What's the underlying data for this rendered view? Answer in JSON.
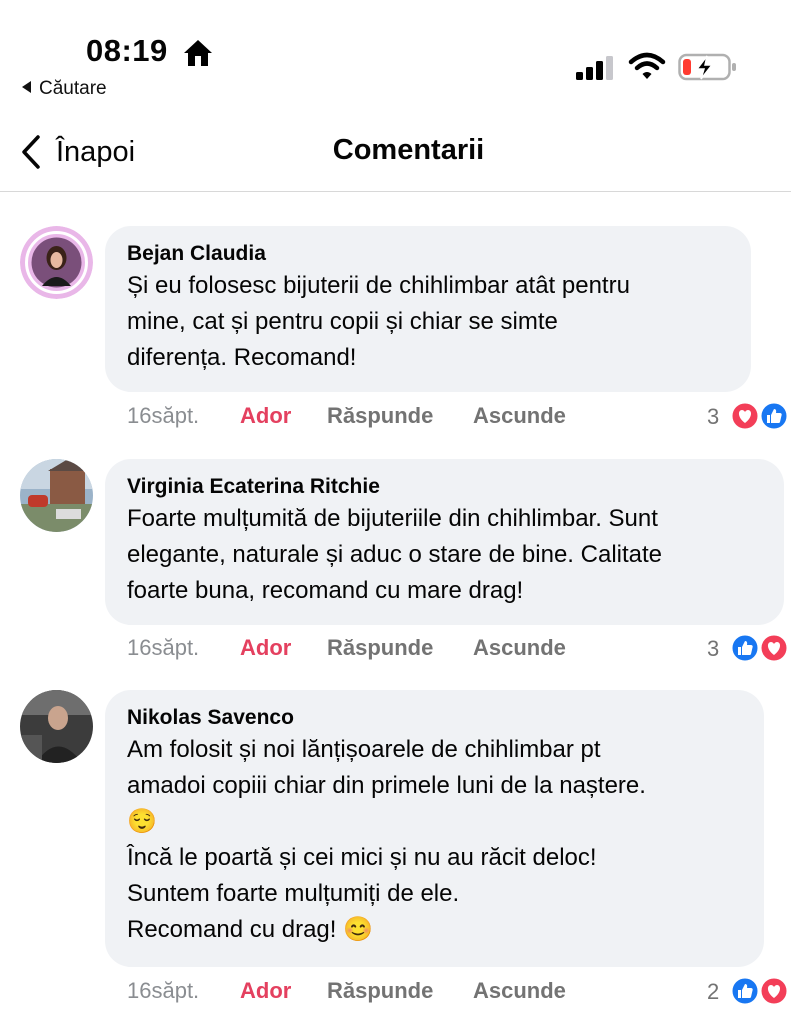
{
  "status_bar": {
    "time": "08:19",
    "back_app_label": "Căutare",
    "icons": [
      "home-icon",
      "signal-icon",
      "wifi-icon",
      "battery-charging-icon"
    ]
  },
  "nav": {
    "back_label": "Înapoi",
    "title": "Comentarii"
  },
  "colors": {
    "bubble": "#f0f2f5",
    "like_action": "#e4405f",
    "meta_gray": "#8a8d91",
    "like_blue": "#1877f2",
    "love_red": "#f33e58"
  },
  "comments": [
    {
      "author": "Bejan Claudia",
      "text": "Și eu folosesc bijuterii de chihlimbar atât pentru\nmine, cat și pentru copii și chiar se simte\ndiferența. Recomand!",
      "time": "16săpt.",
      "like_label": "Ador",
      "reply_label": "Răspunde",
      "hide_label": "Ascunde",
      "reaction_count": "3",
      "reactions": [
        "love",
        "like"
      ]
    },
    {
      "author": "Virginia Ecaterina Ritchie",
      "text": "Foarte mulțumită de bijuteriile din chihlimbar. Sunt\nelegante, naturale și aduc o stare de bine. Calitate\nfoarte buna, recomand cu mare drag!",
      "time": "16săpt.",
      "like_label": "Ador",
      "reply_label": "Răspunde",
      "hide_label": "Ascunde",
      "reaction_count": "3",
      "reactions": [
        "like",
        "love"
      ]
    },
    {
      "author": "Nikolas Savenco",
      "text": "Am folosit și noi lănțișoarele de chihlimbar pt\namadoi copiii chiar din primele luni de la naștere.\n😌\nÎncă le poartă și cei mici și nu au răcit deloc!\nSuntem foarte mulțumiți de ele.\nRecomand cu drag! 😊",
      "time": "16săpt.",
      "like_label": "Ador",
      "reply_label": "Răspunde",
      "hide_label": "Ascunde",
      "reaction_count": "2",
      "reactions": [
        "like",
        "love"
      ]
    }
  ]
}
